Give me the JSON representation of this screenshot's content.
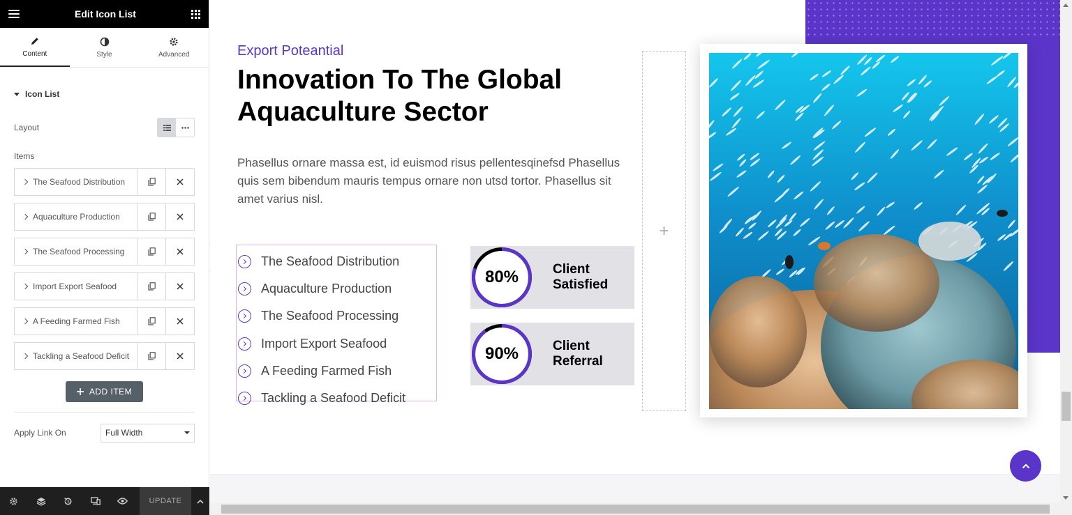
{
  "panel": {
    "title": "Edit Icon List",
    "tabs": [
      {
        "label": "Content",
        "icon": "pencil-icon",
        "active": true
      },
      {
        "label": "Style",
        "icon": "contrast-icon",
        "active": false
      },
      {
        "label": "Advanced",
        "icon": "gear-icon",
        "active": false
      }
    ],
    "section_title": "Icon List",
    "layout_label": "Layout",
    "items_label": "Items",
    "items": [
      {
        "label": "The Seafood Distribution"
      },
      {
        "label": "Aquaculture Production"
      },
      {
        "label": "The Seafood Processing"
      },
      {
        "label": "Import Export Seafood"
      },
      {
        "label": "A Feeding Farmed Fish"
      },
      {
        "label": "Tackling a Seafood Deficit"
      }
    ],
    "add_item_label": "ADD ITEM",
    "apply_link_label": "Apply Link On",
    "apply_link_value": "Full Width",
    "footer_update_label": "UPDATE"
  },
  "canvas": {
    "eyebrow": "Export Poteantial",
    "headline": "Innovation To The Global Aquaculture Sector",
    "lead": "Phasellus ornare massa est, id euismod risus pellentesqinefsd Phasellus quis sem bibendum mauris tempus ornare non utsd tortor. Phasellus sit amet varius nisl.",
    "icon_list": [
      "The Seafood Distribution",
      "Aquaculture Production",
      "The Seafood Processing",
      "Import Export Seafood",
      "A Feeding Farmed Fish",
      "Tackling a Seafood Deficit"
    ],
    "stats": [
      {
        "percent_label": "80%",
        "value": 0.8,
        "label_line1": "Client",
        "label_line2": "Satisfied"
      },
      {
        "percent_label": "90%",
        "value": 0.9,
        "label_line1": "Client",
        "label_line2": "Referral"
      }
    ],
    "add_section_glyph": "+"
  },
  "colors": {
    "accent": "#5b35c9",
    "panel_header": "#000000",
    "footer": "#1f1f1f",
    "stat_bg": "#e1e1e6"
  }
}
